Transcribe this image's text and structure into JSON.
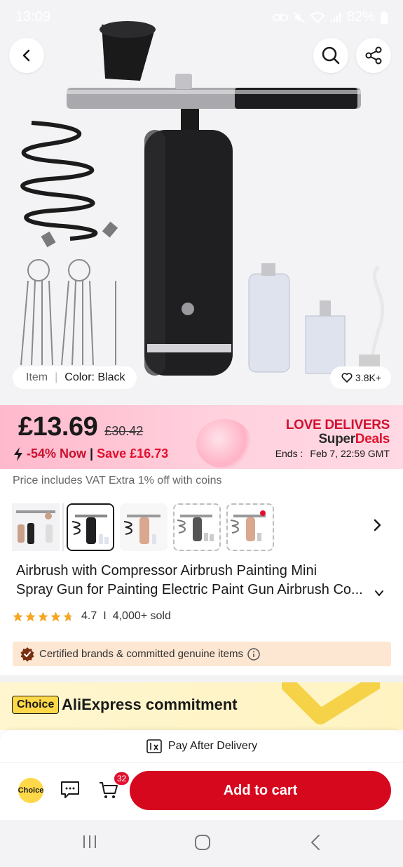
{
  "status_bar": {
    "time": "13:09",
    "battery": "82%"
  },
  "hero": {
    "item_label": "Item",
    "color_label": "Color: Black",
    "wishlist_count": "3.8K+"
  },
  "price": {
    "current": "£13.69",
    "original": "£30.42",
    "discount": "-54% Now",
    "save": "Save £16.73",
    "promo_title": "LOVE DELIVERS",
    "promo_sub_1": "Super",
    "promo_sub_2": "Deals",
    "ends_label": "Ends :",
    "ends_value": "Feb 7, 22:59 GMT"
  },
  "vat_note": "Price includes VAT Extra 1% off with coins",
  "thumbnails": [
    {
      "name": "Bundle",
      "selected": false
    },
    {
      "name": "Black",
      "selected": true
    },
    {
      "name": "Rose Gold",
      "selected": false
    },
    {
      "name": "Black set",
      "selected": false
    },
    {
      "name": "Rose Gold set",
      "selected": false
    }
  ],
  "product": {
    "title_line1": "Airbrush with Compressor Airbrush Painting Mini",
    "title_line2": "Spray Gun for Painting Electric Paint Gun Airbrush Co...",
    "rating": "4.7",
    "sold": "4,000+ sold",
    "stars": 4.7
  },
  "certified": "Certified brands & committed genuine items",
  "commitment": {
    "badge": "Choice",
    "title": "AliExpress commitment"
  },
  "bottom": {
    "pay_after": "Pay After Delivery",
    "choice_label": "Choice",
    "cart_count": "32",
    "add_to_cart": "Add to cart"
  },
  "colors": {
    "accent": "#d6081e",
    "promo_red": "#e1112e",
    "choice_yellow": "#ffd84a"
  }
}
